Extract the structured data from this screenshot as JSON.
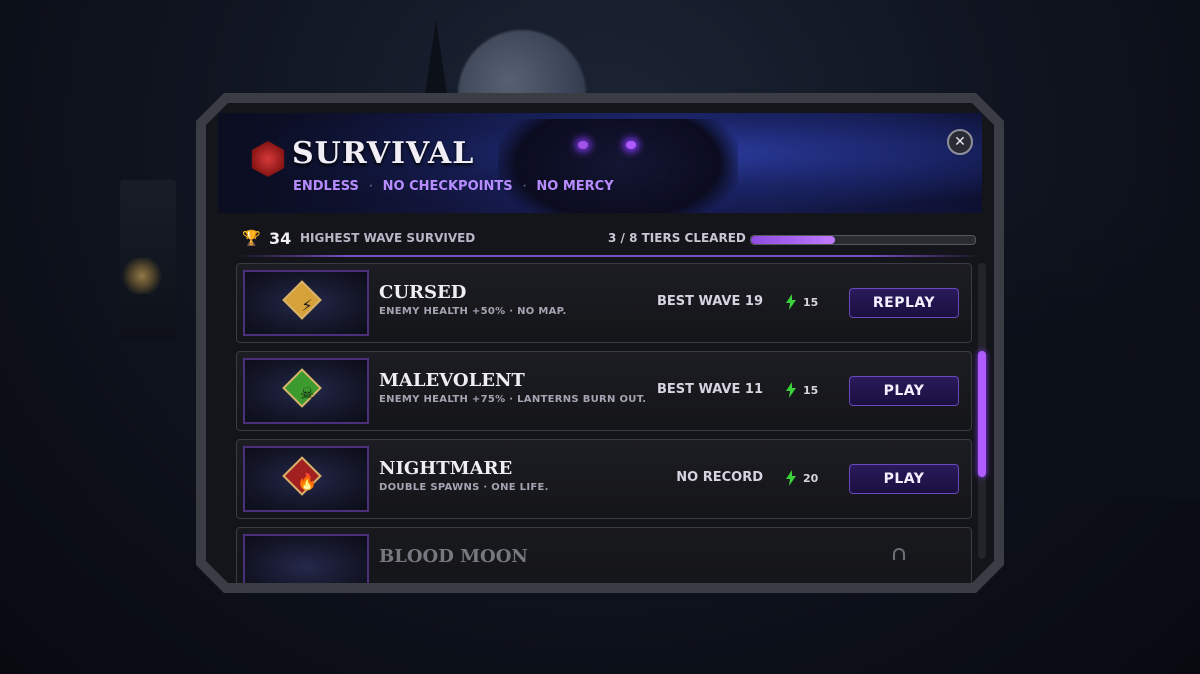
{
  "header": {
    "title": "SURVIVAL",
    "tags": [
      "ENDLESS",
      "NO CHECKPOINTS",
      "NO MERCY"
    ]
  },
  "stats": {
    "highest_wave": "34",
    "highest_wave_label": "HIGHEST WAVE SURVIVED",
    "tiers_label": "3 / 8 TIERS CLEARED",
    "tiers_progress": 0.375
  },
  "tiers": [
    {
      "name": "CURSED",
      "desc": "ENEMY HEALTH +50% · NO MAP.",
      "best": "BEST WAVE  19",
      "energy": "15",
      "action": "REPLAY",
      "icon": "lightning-icon",
      "gem_color": "#d7a13a",
      "icon_color": "#1b1b1b"
    },
    {
      "name": "MALEVOLENT",
      "desc": "ENEMY HEALTH +75% · LANTERNS BURN OUT.",
      "best": "BEST WAVE  11",
      "energy": "15",
      "action": "PLAY",
      "icon": "skull-icon",
      "gem_color": "#3d9a2f",
      "icon_color": "#0f1a0c"
    },
    {
      "name": "NIGHTMARE",
      "desc": "DOUBLE SPAWNS · ONE LIFE.",
      "best": "NO RECORD",
      "energy": "20",
      "action": "PLAY",
      "icon": "flame-icon",
      "gem_color": "#a32020",
      "icon_color": "#ff7a2a"
    },
    {
      "name": "BLOOD MOON",
      "icon": "lock-icon"
    }
  ],
  "colors": {
    "accent": "#b05cff",
    "energy": "#3bd13b"
  }
}
